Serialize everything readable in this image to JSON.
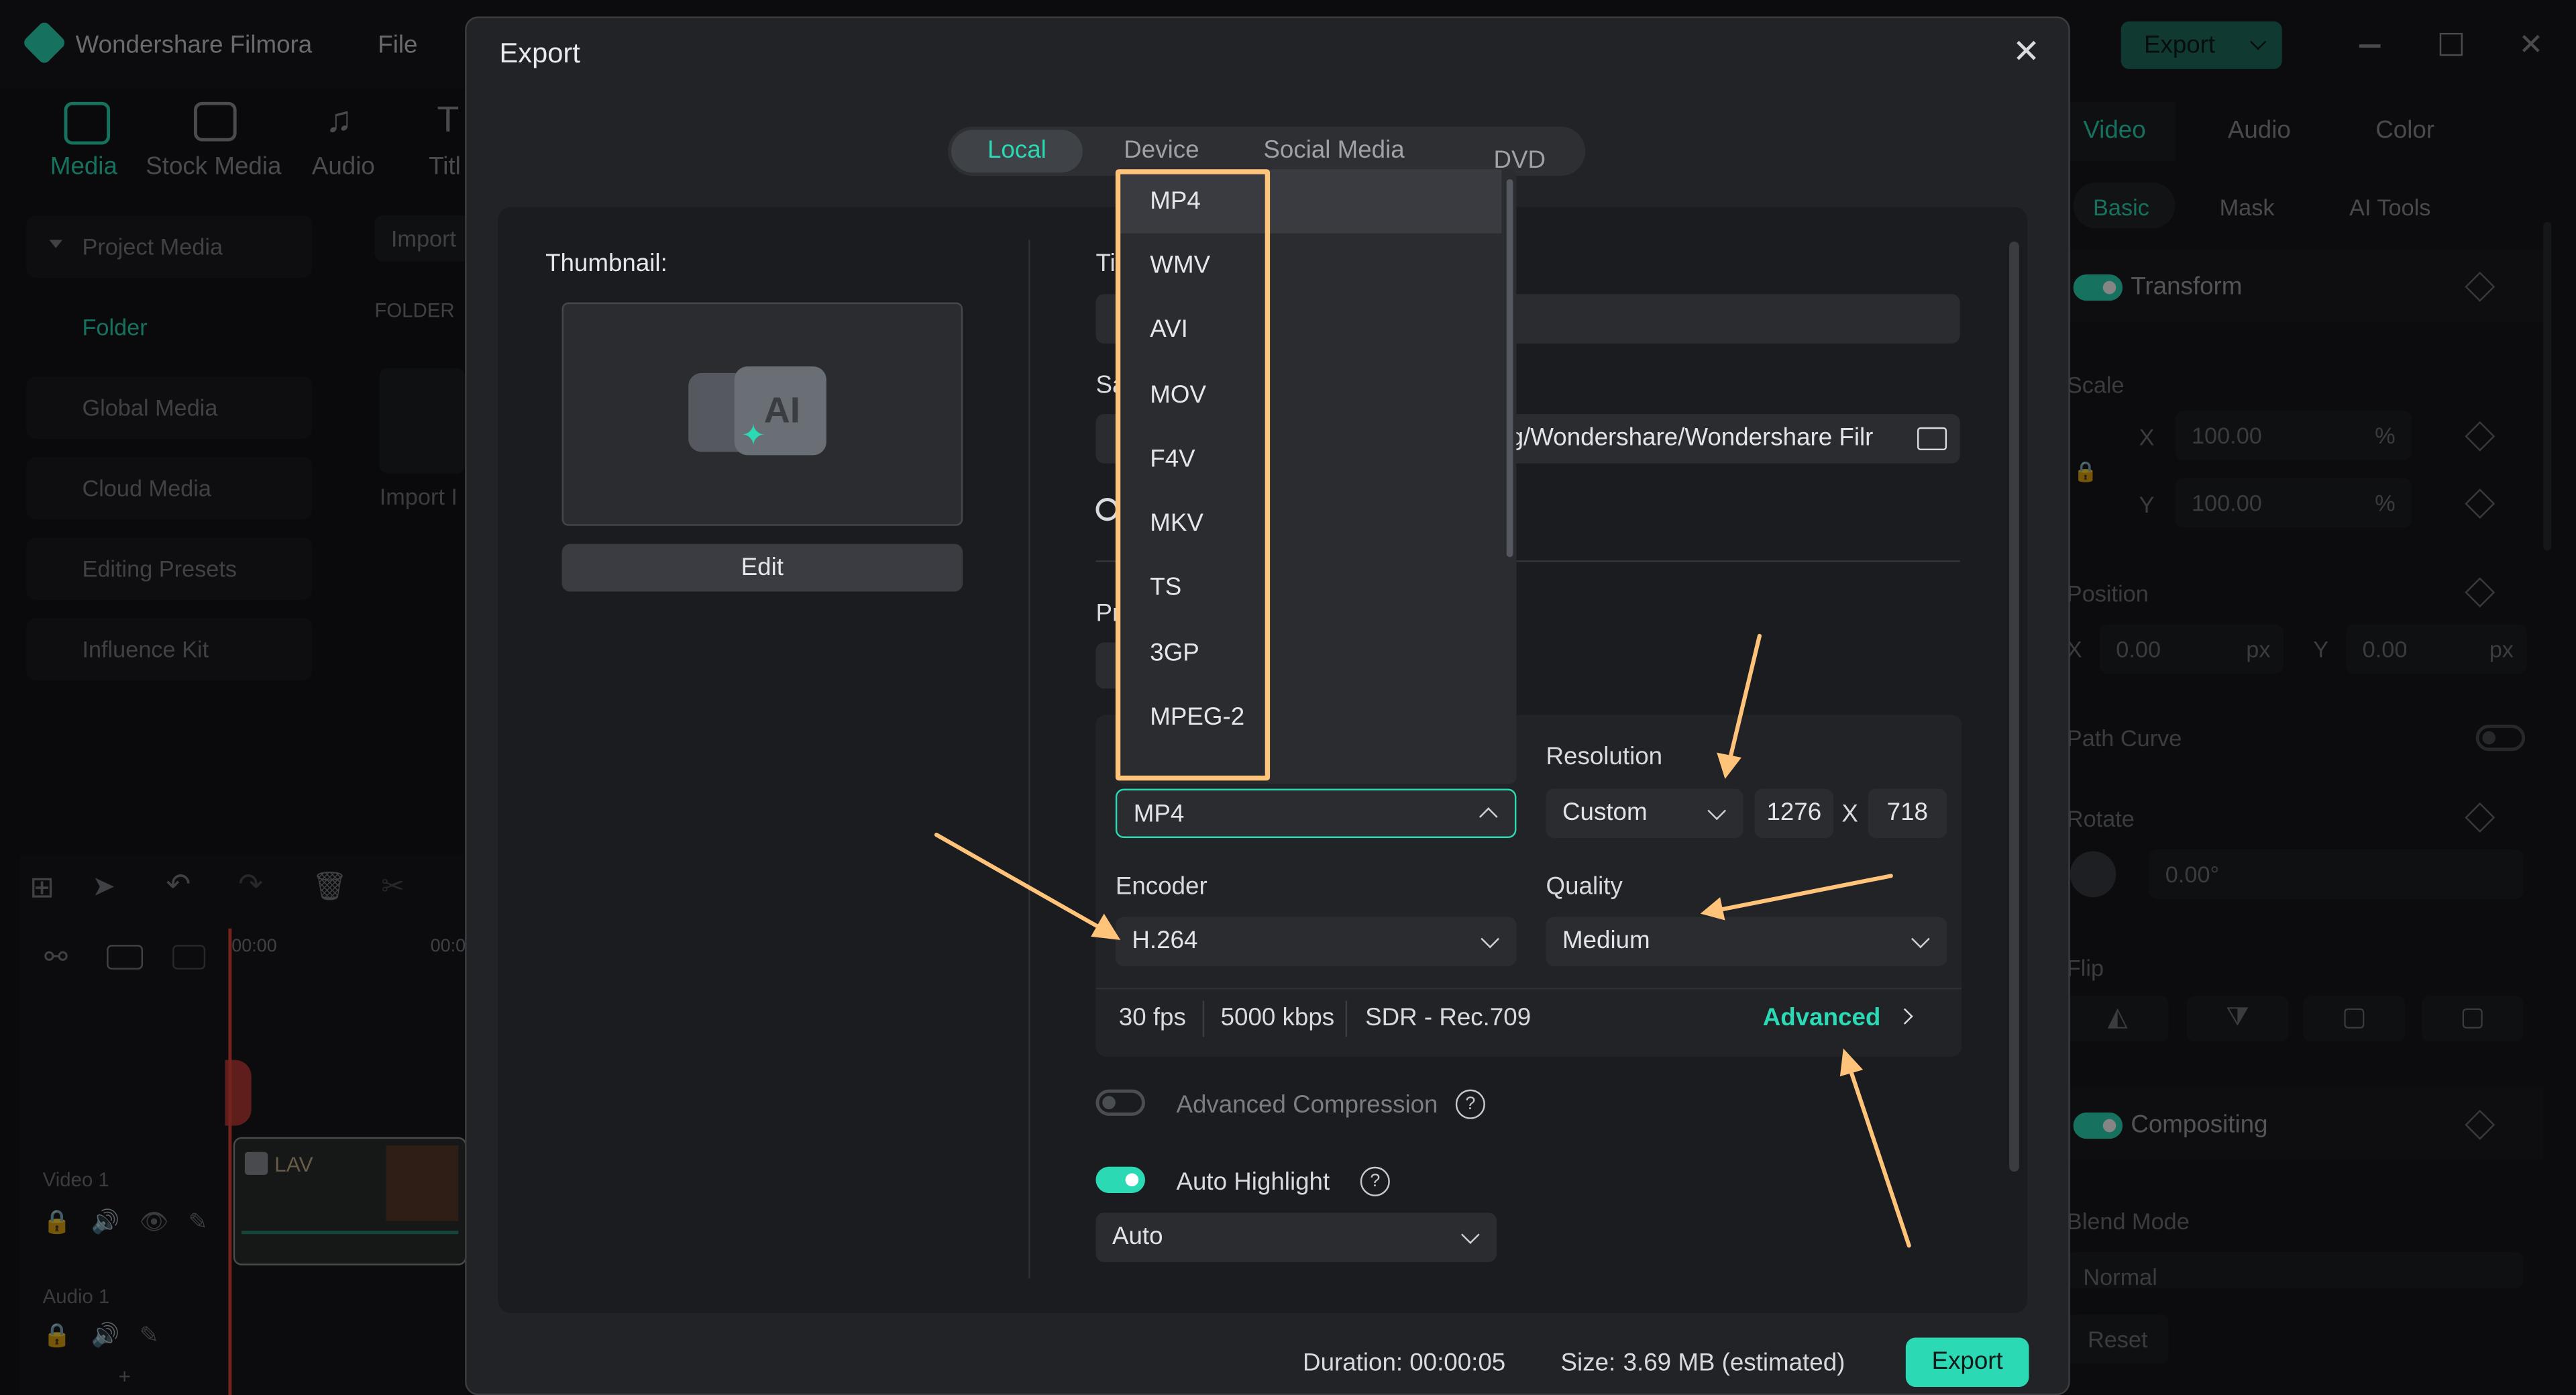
{
  "app": {
    "title": "Wondershare Filmora",
    "menu_file": "File",
    "export_button": "Export",
    "nav": [
      {
        "label": "Media"
      },
      {
        "label": "Stock Media"
      },
      {
        "label": "Audio"
      },
      {
        "label": "Titl"
      }
    ],
    "sidebar": [
      {
        "label": "Project Media"
      },
      {
        "label": "Folder"
      },
      {
        "label": "Global Media"
      },
      {
        "label": "Cloud Media"
      },
      {
        "label": "Editing Presets"
      },
      {
        "label": "Influence Kit"
      }
    ],
    "media_import": "Import",
    "folder_header": "FOLDER",
    "import_label": "Import I",
    "timeline": {
      "start": "00:00",
      "next": "00:0",
      "video_track": "Video 1",
      "audio_track": "Audio 1",
      "clip_label": "LAV"
    },
    "right_panel": {
      "tabs": [
        "Video",
        "Audio",
        "Color"
      ],
      "subtabs": [
        "Basic",
        "Mask",
        "AI Tools"
      ],
      "transform": "Transform",
      "scale": "Scale",
      "scale_x_label": "X",
      "scale_x": "100.00",
      "scale_y_label": "Y",
      "scale_y": "100.00",
      "percent": "%",
      "position": "Position",
      "pos_x_label": "X",
      "pos_x": "0.00",
      "pos_y_label": "Y",
      "pos_y": "0.00",
      "px": "px",
      "path_curve": "Path Curve",
      "rotate": "Rotate",
      "rotate_value": "0.00°",
      "flip": "Flip",
      "compositing": "Compositing",
      "blend_mode": "Blend Mode",
      "blend_value": "Normal",
      "reset": "Reset"
    }
  },
  "export_dialog": {
    "title": "Export",
    "tabs": [
      {
        "label": "Local",
        "active": true
      },
      {
        "label": "Device",
        "active": false
      },
      {
        "label": "Social Media",
        "active": false
      },
      {
        "label": "DVD",
        "active": false
      }
    ],
    "thumbnail_label": "Thumbnail:",
    "edit_button": "Edit",
    "title_label_fragment": "Ti",
    "save_label_fragment": "Sa",
    "save_path": "g/Wondershare/Wondershare Filr",
    "preset_label_fragment": "Pr",
    "format_options": [
      "MP4",
      "WMV",
      "AVI",
      "MOV",
      "F4V",
      "MKV",
      "TS",
      "3GP",
      "MPEG-2"
    ],
    "format_selected": "MP4",
    "resolution_label": "Resolution",
    "resolution_mode": "Custom",
    "resolution_width": "1276",
    "resolution_x": "X",
    "resolution_height": "718",
    "encoder_label": "Encoder",
    "encoder_value": "H.264",
    "quality_label": "Quality",
    "quality_value": "Medium",
    "fps": "30 fps",
    "bitrate": "5000 kbps",
    "color_space": "SDR - Rec.709",
    "advanced_link": "Advanced",
    "advanced_compression": "Advanced Compression",
    "advanced_compression_on": false,
    "auto_highlight": "Auto Highlight",
    "auto_highlight_on": true,
    "auto_highlight_mode": "Auto",
    "duration_label": "Duration:",
    "duration_value": "00:00:05",
    "size_label": "Size:",
    "size_value": "3.69 MB (estimated)",
    "export_button": "Export"
  },
  "colors": {
    "accent": "#2bd9b5",
    "annotation": "#ffc37a"
  }
}
